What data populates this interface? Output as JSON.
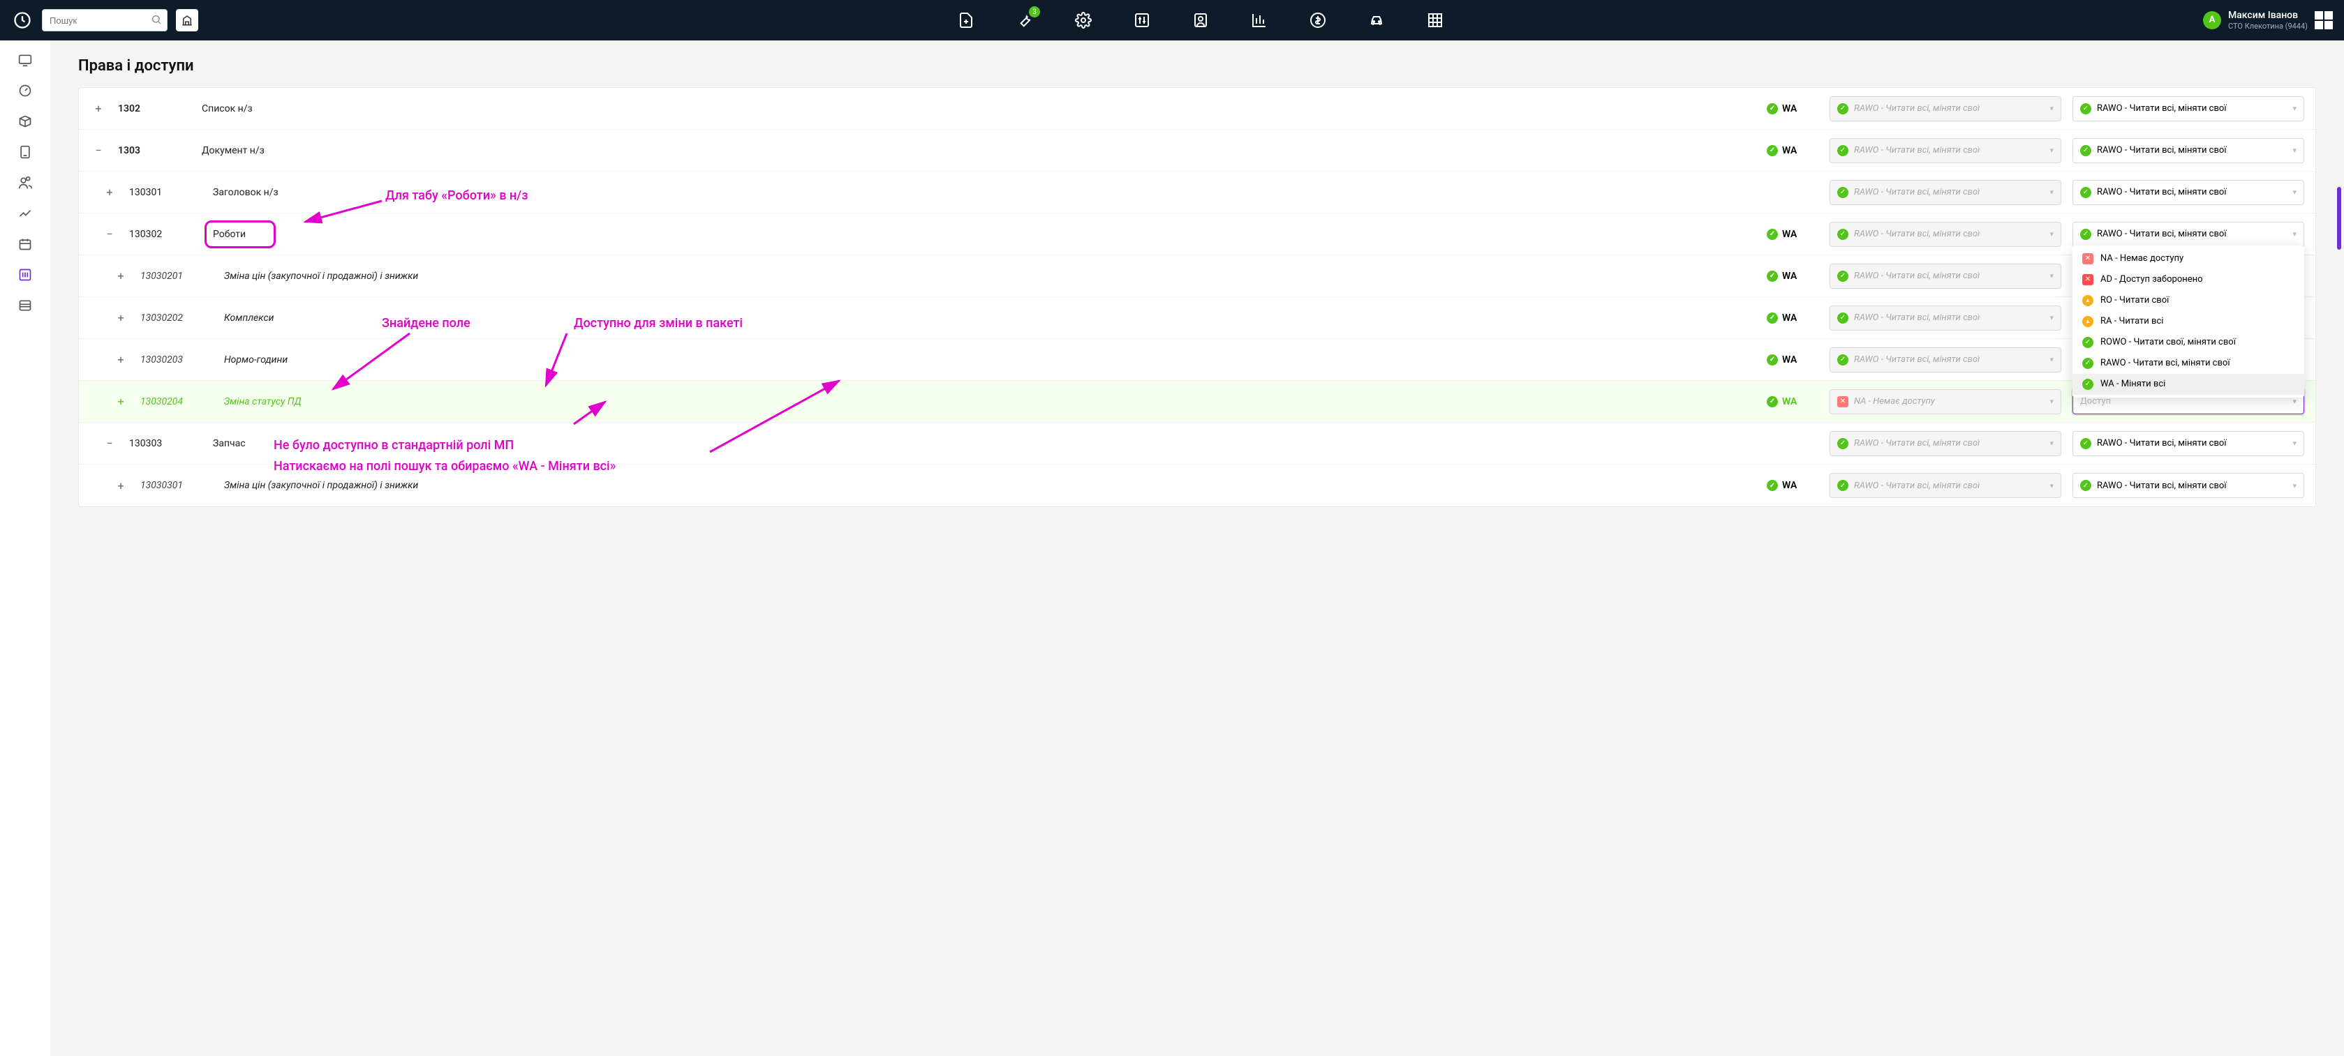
{
  "search_placeholder": "Пошук",
  "nav_badge": "3",
  "user": {
    "name": "Максим Іванов",
    "org": "СТО Клекотина (9444)",
    "initial": "А"
  },
  "page_title": "Права і доступи",
  "rawo_label": "RAWO - Читати всі, міняти свої",
  "na_label": "NA - Немає доступу",
  "access_placeholder": "Доступ",
  "rows": {
    "r1302": {
      "code": "1302",
      "name": "Список н/з",
      "wa": "WA"
    },
    "r1303": {
      "code": "1303",
      "name": "Документ н/з",
      "wa": "WA"
    },
    "r130301": {
      "code": "130301",
      "name": "Заголовок н/з",
      "wa": ""
    },
    "r130302": {
      "code": "130302",
      "name": "Роботи",
      "wa": "WA"
    },
    "r13030201": {
      "code": "13030201",
      "name": "Зміна цін (закупочної і продажної) і знижки",
      "wa": "WA"
    },
    "r13030202": {
      "code": "13030202",
      "name": "Комплекси",
      "wa": "WA"
    },
    "r13030203": {
      "code": "13030203",
      "name": "Нормо-години",
      "wa": "WA"
    },
    "r13030204": {
      "code": "13030204",
      "name": "Зміна статусу ПД",
      "wa": "WA"
    },
    "r130303": {
      "code": "130303",
      "name": "Запчас",
      "wa": ""
    },
    "r13030301": {
      "code": "13030301",
      "name": "Зміна цін (закупочної і продажної) і знижки",
      "wa": "WA"
    }
  },
  "dropdown_options": {
    "na": "NA - Немає доступу",
    "ad": "AD - Доступ заборонено",
    "ro": "RO - Читати свої",
    "ra": "RA - Читати всі",
    "rowo": "ROWO - Читати свої, міняти свої",
    "rawo": "RAWO - Читати всі, міняти свої",
    "wa": "WA - Міняти всі"
  },
  "annotations": {
    "a1": "Для табу «Роботи» в н/з",
    "a2": "Знайдене поле",
    "a3": "Доступно для зміни в пакеті",
    "a4": "Не було доступно в стандартній ролі МП",
    "a5": "Натискаємо на полі пошук та обираємо «WA - Міняти всі»"
  }
}
